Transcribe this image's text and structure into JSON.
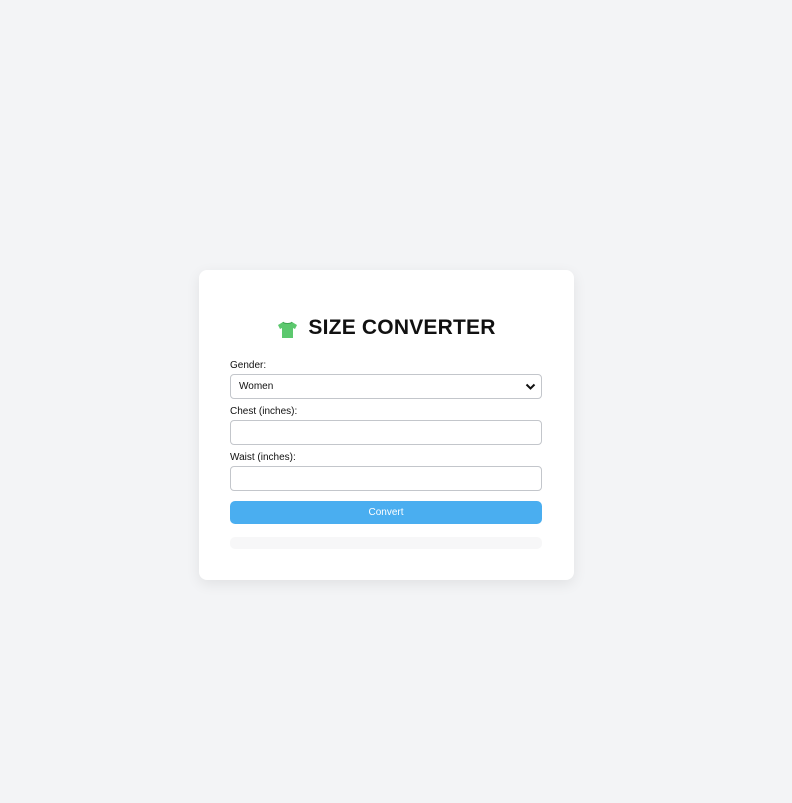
{
  "converter": {
    "title": "SIZE CONVERTER",
    "icon": "tshirt-icon",
    "gender_label": "Gender:",
    "gender_value": "Women",
    "chest_label": "Chest (inches):",
    "chest_value": "",
    "waist_label": "Waist (inches):",
    "waist_value": "",
    "convert_label": "Convert",
    "result_text": ""
  },
  "colors": {
    "page_background": "#f3f4f6",
    "card_background": "#ffffff",
    "accent": "#4aaef0",
    "icon_green": "#5cc86e"
  }
}
